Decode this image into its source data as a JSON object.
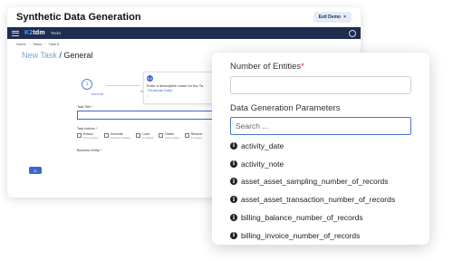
{
  "background_app": {
    "header_title": "Synthetic Data Generation",
    "exit_button": "Exit Demo",
    "exit_close": "×",
    "logo_prefix": "K2",
    "logo_suffix": "tdm",
    "nav_tasks": "Tasks",
    "breadcrumb": [
      "Home",
      "Tasks",
      "Task #"
    ],
    "page_title_prefix": "New Task",
    "page_title": "/ General",
    "stepper_number": "1",
    "step_label_general": "General",
    "step_label_next": "Ad",
    "tooltip_icon": "K2",
    "tooltip_text": "Enter a descriptive name for the Ta",
    "tooltip_quote": "\"Generate Data\"",
    "tooltip_more": "• ",
    "task_title_label": "Task Title *",
    "task_actions_label": "Task Actions *",
    "actions": [
      {
        "label": "Extract",
        "sub": "(from source)"
      },
      {
        "label": "Generate",
        "sub": "(synthetic entities)"
      },
      {
        "label": "Load",
        "sub": "(to target)"
      },
      {
        "label": "Delete",
        "sub": "(from target)"
      },
      {
        "label": "Reserve",
        "sub": "(in target)"
      }
    ],
    "business_entity_label": "Business Entity *",
    "blue_button": "D"
  },
  "panel": {
    "entities_label": "Number of Entities",
    "required_mark": "*",
    "params_label": "Data Generation Parameters",
    "search_placeholder": "Search ...",
    "options": [
      "activity_date",
      "activity_note",
      "asset_asset_sampling_number_of_records",
      "asset_asset_transaction_number_of_records",
      "billing_balance_number_of_records",
      "billing_invoice_number_of_records"
    ]
  }
}
